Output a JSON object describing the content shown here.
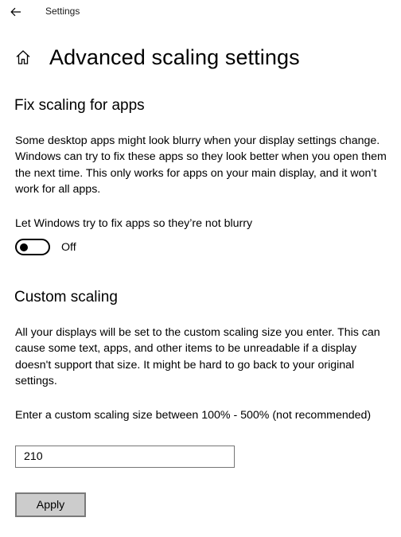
{
  "window": {
    "title": "Settings",
    "back_icon": "arrow-left-icon"
  },
  "header": {
    "home_icon": "home-icon",
    "title": "Advanced scaling settings"
  },
  "fix_scaling": {
    "heading": "Fix scaling for apps",
    "description": "Some desktop apps might look blurry when your display settings change. Windows can try to fix these apps so they look better when you open them the next time. This only works for apps on your main display, and it won’t work for all apps.",
    "toggle_label": "Let Windows try to fix apps so they’re not blurry",
    "toggle_state": "Off",
    "toggle_on": false
  },
  "custom_scaling": {
    "heading": "Custom scaling",
    "description": "All your displays will be set to the custom scaling size you enter. This can cause some text, apps, and other items to be unreadable if a display doesn't support that size. It might be hard to go back to your original settings.",
    "input_label": "Enter a custom scaling size between 100% - 500% (not recommended)",
    "input_value": "210",
    "apply_label": "Apply"
  },
  "colors": {
    "background": "#ffffff",
    "text": "#000000",
    "button_bg": "#cccccc",
    "button_border": "#7a7a7a",
    "input_border": "#767676"
  }
}
